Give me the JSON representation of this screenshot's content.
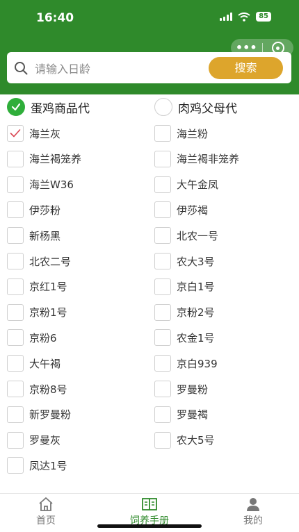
{
  "status_bar": {
    "time": "16:40",
    "battery": "85"
  },
  "search": {
    "placeholder": "请输入日龄",
    "button_label": "搜索"
  },
  "categories": [
    {
      "label": "蛋鸡商品代",
      "selected": true
    },
    {
      "label": "肉鸡父母代",
      "selected": false
    }
  ],
  "breeds": [
    {
      "label": "海兰灰",
      "checked": true
    },
    {
      "label": "海兰粉",
      "checked": false
    },
    {
      "label": "海兰褐笼养",
      "checked": false
    },
    {
      "label": "海兰褐非笼养",
      "checked": false
    },
    {
      "label": "海兰W36",
      "checked": false
    },
    {
      "label": "大午金凤",
      "checked": false
    },
    {
      "label": "伊莎粉",
      "checked": false
    },
    {
      "label": "伊莎褐",
      "checked": false
    },
    {
      "label": "新杨黑",
      "checked": false
    },
    {
      "label": "北农一号",
      "checked": false
    },
    {
      "label": "北农二号",
      "checked": false
    },
    {
      "label": "农大3号",
      "checked": false
    },
    {
      "label": "京红1号",
      "checked": false
    },
    {
      "label": "京白1号",
      "checked": false
    },
    {
      "label": "京粉1号",
      "checked": false
    },
    {
      "label": "京粉2号",
      "checked": false
    },
    {
      "label": "京粉6",
      "checked": false
    },
    {
      "label": "农金1号",
      "checked": false
    },
    {
      "label": "大午褐",
      "checked": false
    },
    {
      "label": "京白939",
      "checked": false
    },
    {
      "label": "京粉8号",
      "checked": false
    },
    {
      "label": "罗曼粉",
      "checked": false
    },
    {
      "label": "新罗曼粉",
      "checked": false
    },
    {
      "label": "罗曼褐",
      "checked": false
    },
    {
      "label": "罗曼灰",
      "checked": false
    },
    {
      "label": "农大5号",
      "checked": false
    },
    {
      "label": "凤达1号",
      "checked": false
    }
  ],
  "tabbar": {
    "home": "首页",
    "manual": "饲养手册",
    "mine": "我的"
  },
  "colors": {
    "brand_green": "#2f8a2b",
    "accent_gold": "#dda52c",
    "check_green": "#2fae3a",
    "check_red": "#d9434f"
  }
}
